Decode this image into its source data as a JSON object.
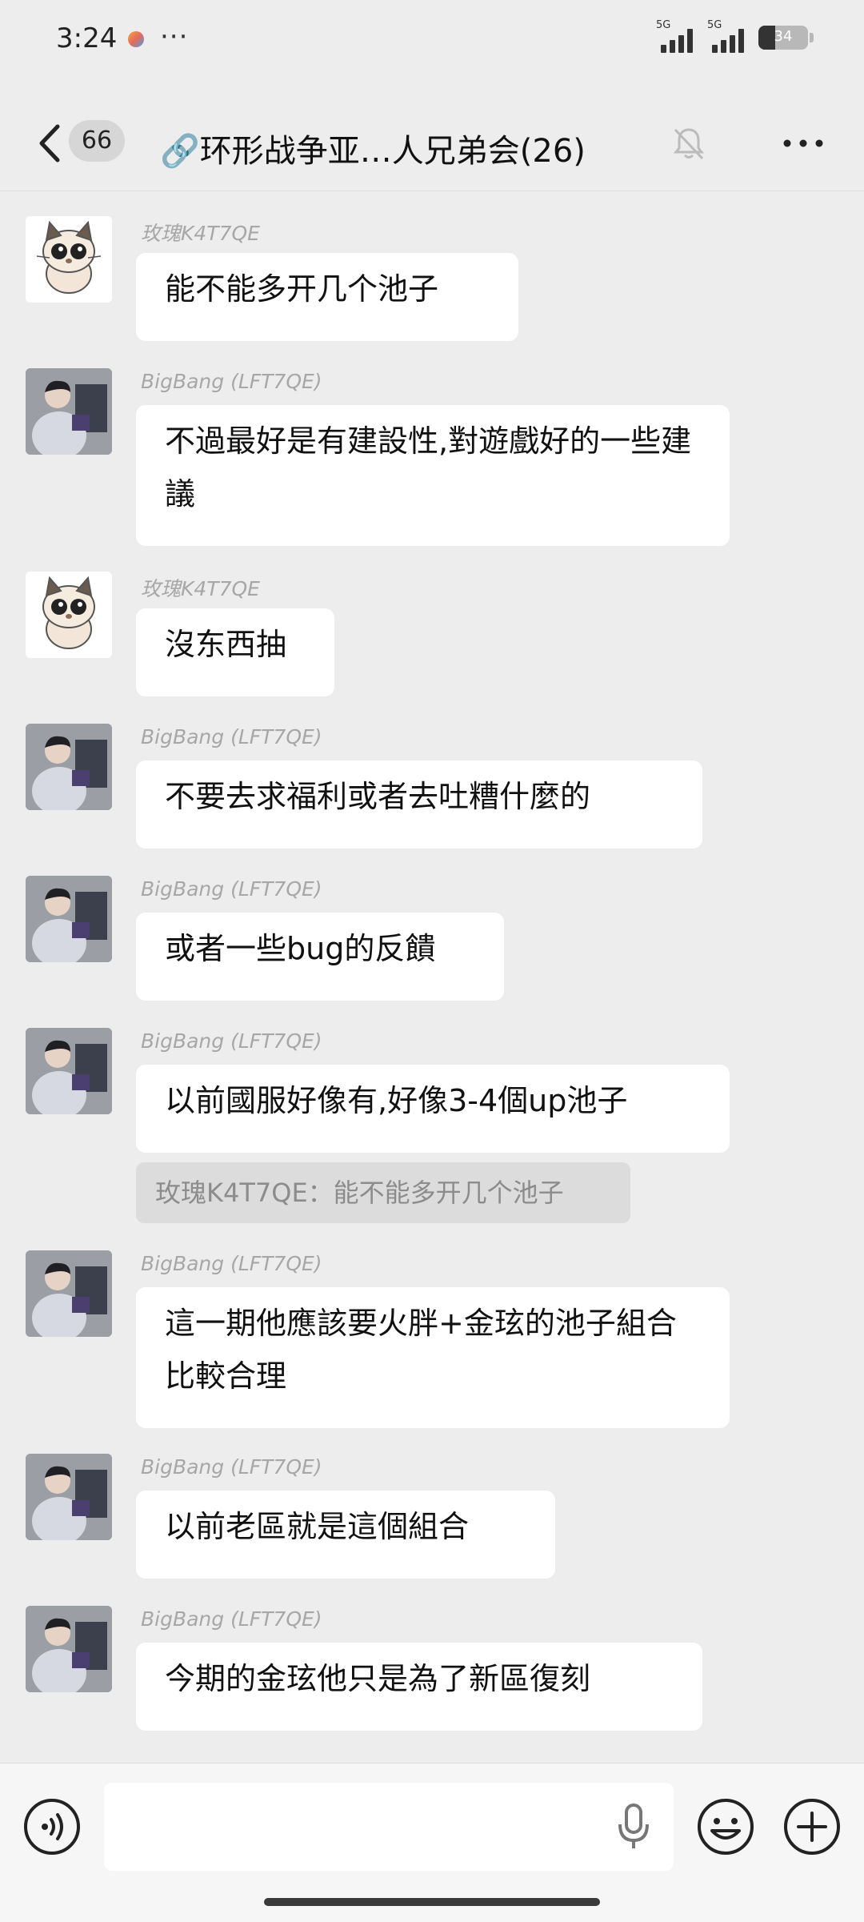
{
  "status_bar": {
    "time": "3:24",
    "more": "···",
    "signal1_label": "5G",
    "signal2_label": "5G",
    "battery": "34",
    "battery_level": 0.34
  },
  "nav": {
    "unread_count": "66",
    "title": "🔗环形战争亚…人兄弟会(26)"
  },
  "messages": [
    {
      "sender": "玫瑰K4T7QE",
      "text": "能不能多开几个池子"
    },
    {
      "sender": "BigBang (LFT7QE)",
      "text": "不過最好是有建設性,對遊戲好的一些建議"
    },
    {
      "sender": "玫瑰K4T7QE",
      "text": "沒东西抽"
    },
    {
      "sender": "BigBang (LFT7QE)",
      "text": "不要去求福利或者去吐糟什麼的"
    },
    {
      "sender": "BigBang (LFT7QE)",
      "text": "或者一些bug的反饋"
    },
    {
      "sender": "BigBang (LFT7QE)",
      "text": "以前國服好像有,好像3-4個up池子",
      "quote": "玫瑰K4T7QE：能不能多开几个池子"
    },
    {
      "sender": "BigBang (LFT7QE)",
      "text": "這一期他應該要火胖+金玹的池子組合比較合理"
    },
    {
      "sender": "BigBang (LFT7QE)",
      "text": "以前老區就是這個組合"
    },
    {
      "sender": "BigBang (LFT7QE)",
      "text": "今期的金玹他只是為了新區復刻"
    }
  ],
  "colors": {
    "background": "#ededed",
    "bubble": "#ffffff",
    "quote": "#dcdcdc",
    "sender": "#a7a7a7"
  },
  "icons": {
    "back": "chevron-left-icon",
    "mute": "bell-off-icon",
    "more": "more-dots-icon",
    "voice": "voice-toggle-icon",
    "mic": "microphone-icon",
    "emoji": "emoji-icon",
    "plus": "plus-icon"
  }
}
